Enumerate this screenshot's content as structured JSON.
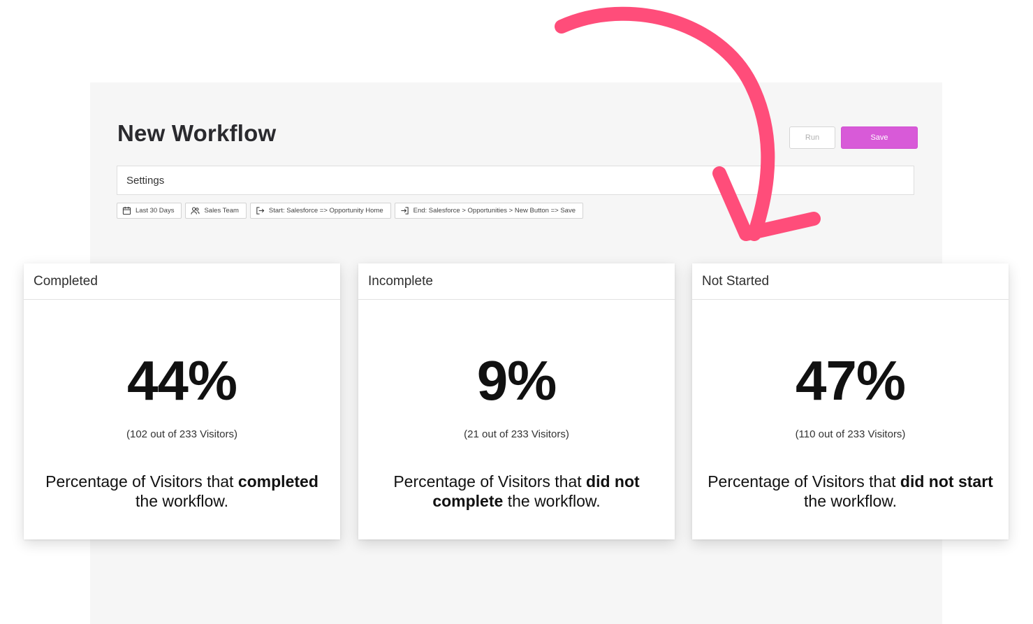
{
  "header": {
    "title": "New Workflow"
  },
  "toolbar": {
    "run_label": "Run",
    "save_label": "Save"
  },
  "settings": {
    "label": "Settings"
  },
  "filters": [
    {
      "label": "Last 30 Days",
      "icon": "calendar-icon"
    },
    {
      "label": "Sales Team",
      "icon": "users-icon"
    },
    {
      "label": "Start: Salesforce => Opportunity Home",
      "icon": "exit-icon"
    },
    {
      "label": "End: Salesforce > Opportunities > New Button => Save",
      "icon": "enter-icon"
    }
  ],
  "cards": [
    {
      "title": "Completed",
      "percent": "44%",
      "count": "(102 out of 233 Visitors)",
      "desc_pre": "Percentage of Visitors that ",
      "desc_bold": "completed",
      "desc_post": " the workflow."
    },
    {
      "title": "Incomplete",
      "percent": "9%",
      "count": "(21 out of 233 Visitors)",
      "desc_pre": "Percentage of Visitors that ",
      "desc_bold": "did not complete",
      "desc_post": " the workflow."
    },
    {
      "title": "Not Started",
      "percent": "47%",
      "count": "(110 out of 233 Visitors)",
      "desc_pre": "Percentage of Visitors that ",
      "desc_bold": "did not start",
      "desc_post": " the workflow."
    }
  ],
  "colors": {
    "accent": "#d85ad8",
    "arrow": "#ff4d7a",
    "panel": "#f6f6f6"
  }
}
